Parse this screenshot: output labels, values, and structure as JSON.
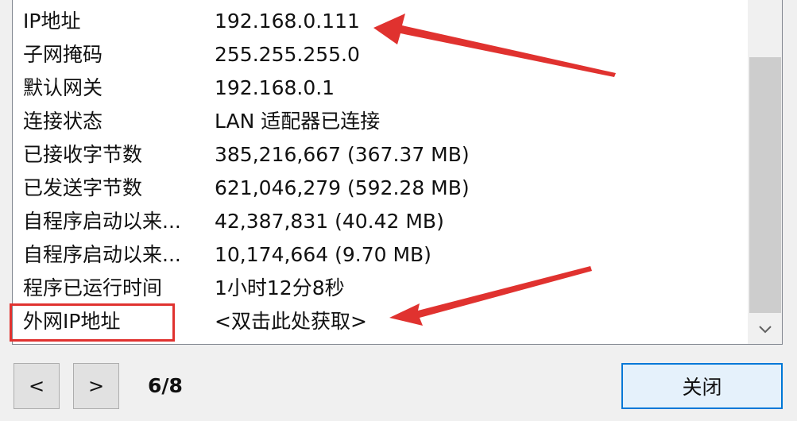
{
  "rows": [
    {
      "key": "IP地址",
      "value": "192.168.0.111"
    },
    {
      "key": "子网掩码",
      "value": "255.255.255.0"
    },
    {
      "key": "默认网关",
      "value": "192.168.0.1"
    },
    {
      "key": "连接状态",
      "value": "LAN 适配器已连接"
    },
    {
      "key": "已接收字节数",
      "value": "385,216,667 (367.37 MB)"
    },
    {
      "key": "已发送字节数",
      "value": "621,046,279 (592.28 MB)"
    },
    {
      "key": "自程序启动以来...",
      "value": "42,387,831 (40.42 MB)"
    },
    {
      "key": "自程序启动以来...",
      "value": "10,174,664 (9.70 MB)"
    },
    {
      "key": "程序已运行时间",
      "value": "1小时12分8秒"
    },
    {
      "key": "外网IP地址",
      "value": "<双击此处获取>"
    }
  ],
  "pager": {
    "prev_label": "<",
    "next_label": ">",
    "page": "6/8"
  },
  "close_label": "关闭",
  "colors": {
    "annotation_red": "#e0322f",
    "button_accent": "#0078d7"
  },
  "icons": {
    "scroll_down": "chevron-down-icon"
  }
}
